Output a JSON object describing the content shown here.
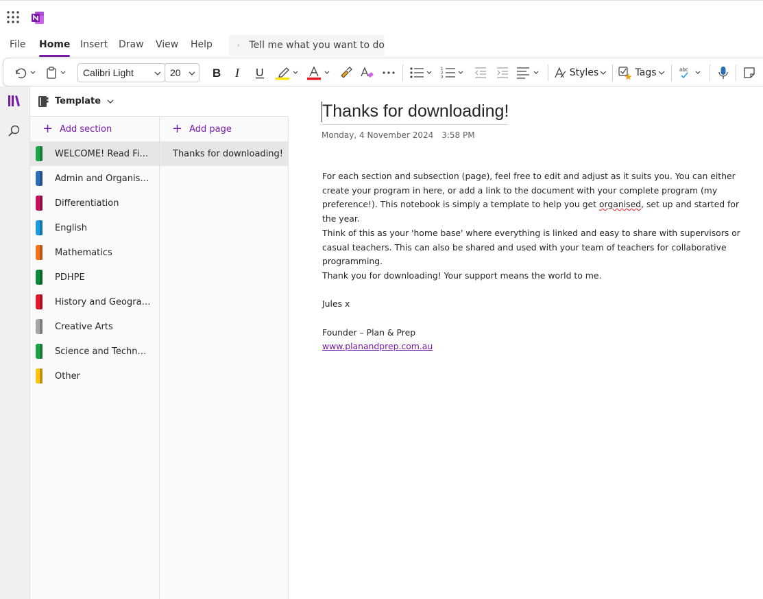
{
  "app": {
    "name": "OneNote",
    "brand_color": "#7719aa"
  },
  "menu": {
    "tabs": [
      "File",
      "Home",
      "Insert",
      "Draw",
      "View",
      "Help"
    ],
    "active": "Home",
    "tell_me_placeholder": "Tell me what you want to do"
  },
  "ribbon": {
    "font_name": "Calibri Light",
    "font_size": "20",
    "styles_label": "Styles",
    "tags_label": "Tags",
    "spell_label": "abc",
    "highlight_color": "#ffe600",
    "font_color": "#e81123"
  },
  "notebook": {
    "title": "Template"
  },
  "sections": {
    "add_label": "Add section",
    "items": [
      {
        "label": "WELCOME! Read First",
        "color": "#1fa347",
        "selected": true
      },
      {
        "label": "Admin and Organisation",
        "color": "#2d6db5",
        "selected": false
      },
      {
        "label": "Differentiation",
        "color": "#c4135e",
        "selected": false
      },
      {
        "label": "English",
        "color": "#1a9de0",
        "selected": false
      },
      {
        "label": "Mathematics",
        "color": "#f2711c",
        "selected": false
      },
      {
        "label": "PDHPE",
        "color": "#0f8a3c",
        "selected": false
      },
      {
        "label": "History and Geography",
        "color": "#e31b2d",
        "selected": false
      },
      {
        "label": "Creative Arts",
        "color": "#a6a6a6",
        "selected": false
      },
      {
        "label": "Science and Technology",
        "color": "#1fa347",
        "selected": false
      },
      {
        "label": "Other",
        "color": "#ffc20e",
        "selected": false
      }
    ]
  },
  "pages": {
    "add_label": "Add page",
    "items": [
      {
        "label": "Thanks for downloading!",
        "selected": true
      }
    ]
  },
  "page": {
    "title": "Thanks for downloading!",
    "date": "Monday, 4 November 2024",
    "time": "3:58 PM",
    "p1_a": "For each section and subsection (page), feel free to edit and adjust as it suits you. You can either create your program in here, or add a link to the document with your complete program (my preference!). This notebook is simply a template to help you get ",
    "p1_word": "organised",
    "p1_b": ", set up and started for the year.",
    "p2": "Think of this as your 'home base' where everything is linked and easy to share with supervisors or casual teachers. This can also be shared and used with your team of teachers for collaborative programming.",
    "p3": "Thank you for downloading! Your support means the world to me.",
    "p4": "Jules x",
    "p5": "Founder – Plan & Prep",
    "link": "www.planandprep.com.au"
  }
}
